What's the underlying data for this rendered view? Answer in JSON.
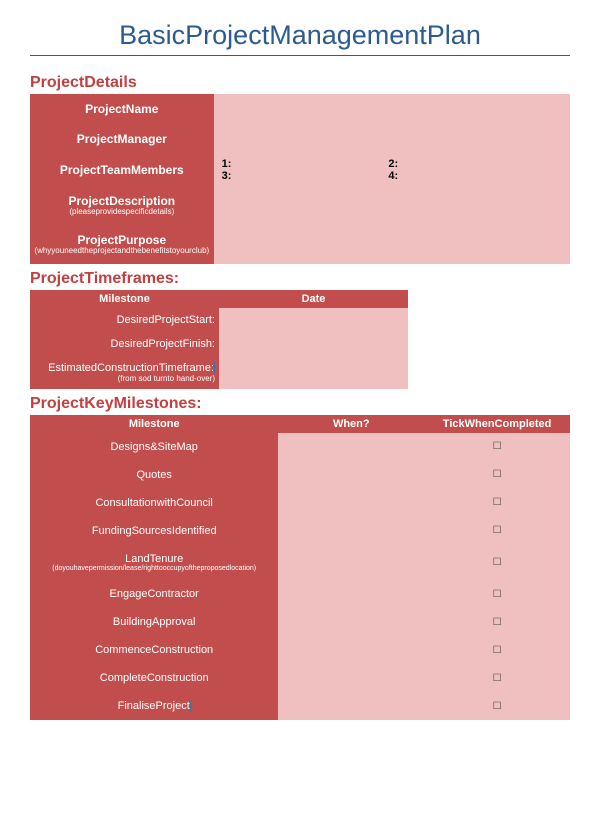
{
  "title": "BasicProjectManagementPlan",
  "sections": {
    "details": {
      "heading": "ProjectDetails",
      "rows": {
        "name": {
          "label": "ProjectName",
          "sub": ""
        },
        "manager": {
          "label": "ProjectManager",
          "sub": ""
        },
        "team": {
          "label": "ProjectTeamMembers",
          "slots": {
            "s1": "1:",
            "s2": "2:",
            "s3": "3:",
            "s4": "4:"
          }
        },
        "desc": {
          "label": "ProjectDescription",
          "sub": "(pleaseprovidespecificdetails)"
        },
        "purpose": {
          "label": "ProjectPurpose",
          "sub": "(whyyouneedtheprojectandthebenefitstoyourclub)"
        }
      }
    },
    "timeframes": {
      "heading": "ProjectTimeframes:",
      "cols": {
        "c1": "Milestone",
        "c2": "Date"
      },
      "rows": {
        "start": {
          "label": "DesiredProjectStart:",
          "sub": ""
        },
        "finish": {
          "label": "DesiredProjectFinish:",
          "sub": ""
        },
        "est": {
          "label": "EstimatedConstructionTimeframe:",
          "sub": "(from sod turnto hand-over)"
        }
      }
    },
    "milestones": {
      "heading": "ProjectKeyMilestones:",
      "cols": {
        "c1": "Milestone",
        "c2": "When?",
        "c3": "TickWhenCompleted"
      },
      "tick": "☐",
      "rows": [
        {
          "label": "Designs&SiteMap",
          "sub": ""
        },
        {
          "label": "Quotes",
          "sub": ""
        },
        {
          "label": "ConsultationwithCouncil",
          "sub": ""
        },
        {
          "label": "FundingSourcesIdentified",
          "sub": ""
        },
        {
          "label": "LandTenure",
          "sub": "(doyouhavepermission/lease/righttooccupyoftheproposedlocation)"
        },
        {
          "label": "EngageContractor",
          "sub": ""
        },
        {
          "label": "BuildingApproval",
          "sub": ""
        },
        {
          "label": "CommenceConstruction",
          "sub": ""
        },
        {
          "label": "CompleteConstruction",
          "sub": ""
        },
        {
          "label": "FinaliseProject",
          "sub": ""
        }
      ]
    }
  }
}
